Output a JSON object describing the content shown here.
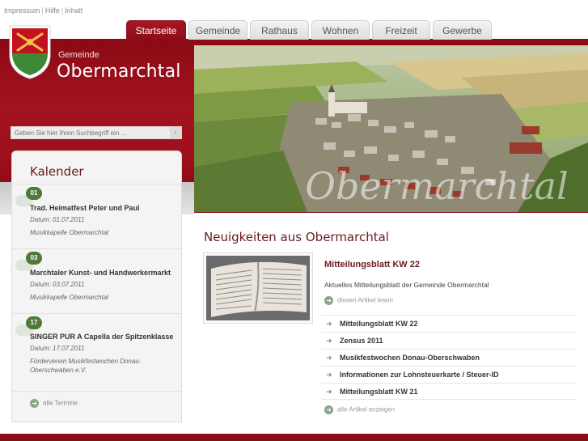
{
  "topnav": {
    "items": [
      "Impressum",
      "Hilfe",
      "Inhalt"
    ]
  },
  "brand": {
    "small": "Gemeinde",
    "big": "Obermarchtal"
  },
  "search": {
    "placeholder": "Geben Sie hier Ihren Suchbegriff ein ..."
  },
  "tabs": [
    {
      "label": "Startseite",
      "active": true
    },
    {
      "label": "Gemeinde",
      "active": false
    },
    {
      "label": "Rathaus",
      "active": false
    },
    {
      "label": "Wohnen",
      "active": false
    },
    {
      "label": "Freizeit",
      "active": false
    },
    {
      "label": "Gewerbe",
      "active": false
    }
  ],
  "hero": {
    "overlay_text": "Obermarchtal"
  },
  "calendar": {
    "title": "Kalender",
    "events": [
      {
        "day": "01",
        "title": "Trad. Heimatfest Peter und Paul",
        "date": "Datum: 01.07.2011",
        "org": "Musikkapelle Obermarchtal"
      },
      {
        "day": "03",
        "title": "Marchtaler Kunst- und Handwerkermarkt",
        "date": "Datum: 03.07.2011",
        "org": "Musikkapelle Obermarchtal"
      },
      {
        "day": "17",
        "title": "SINGER PUR A Capella der Spitzenklasse",
        "date": "Datum: 17.07.2011",
        "org": "Förderverein Musikfestwochen Donau-Oberschwaben e.V."
      }
    ],
    "all_label": "alle Termine"
  },
  "news": {
    "heading": "Neuigkeiten aus Obermarchtal",
    "featured": {
      "title": "Mitteilungsblatt KW 22",
      "text": "Aktuelles Mitteilungsblatt der Gemeinde Obermarchtal",
      "more": "diesen Artikel lesen"
    },
    "items": [
      "Mitteilungsblatt KW 22",
      "Zensus 2011",
      "Musikfestwochen Donau-Oberschwaben",
      "Informationen zur Lohnsteuerkarte / Steuer-ID",
      "Mitteilungsblatt KW 21"
    ],
    "all_label": "alle Artikel anzeigen"
  },
  "colors": {
    "brand_red": "#8c0d17",
    "accent_green": "#4f7a3a"
  }
}
